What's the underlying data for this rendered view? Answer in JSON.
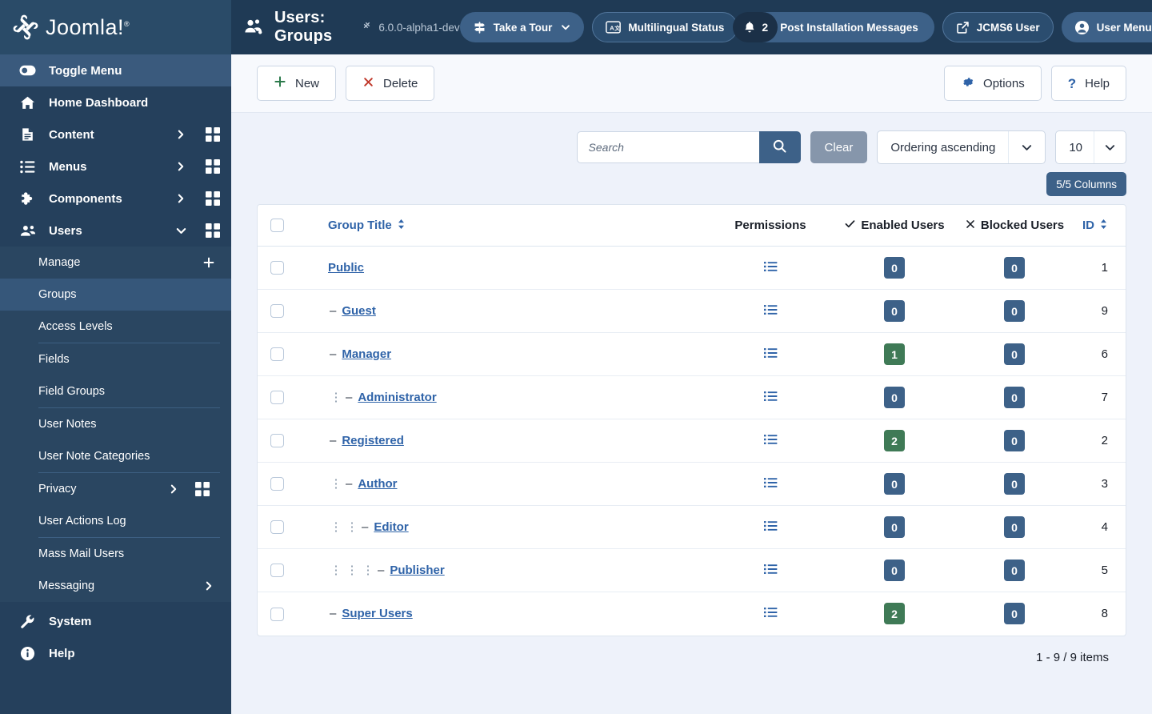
{
  "brand": {
    "name": "Joomla!",
    "trademark": "®"
  },
  "header": {
    "page_icon": "users-gear-icon",
    "page_title": "Users: Groups",
    "version": "6.0.0-alpha1-dev",
    "version_icon": "joomla-mark-icon",
    "actions": {
      "tour": {
        "label": "Take a Tour",
        "icon": "signpost-icon",
        "chevron": "chevron-down-icon"
      },
      "multilingual": {
        "label": "Multilingual Status",
        "icon": "translate-icon"
      },
      "messages": {
        "label": "Post Installation Messages",
        "icon": "bell-icon",
        "count": "2"
      },
      "site": {
        "label": "JCMS6 User",
        "icon": "external-link-icon"
      },
      "user": {
        "label": "User Menu",
        "icon": "user-circle-icon",
        "chevron": "chevron-down-icon"
      }
    }
  },
  "sidebar": {
    "toggle": {
      "label": "Toggle Menu",
      "icon": "toggle-switch-icon"
    },
    "items": [
      {
        "label": "Home Dashboard",
        "icon": "home-icon",
        "arrow": null,
        "grid": false
      },
      {
        "label": "Content",
        "icon": "document-icon",
        "arrow": "chevron-right-icon",
        "grid": true
      },
      {
        "label": "Menus",
        "icon": "list-icon",
        "arrow": "chevron-right-icon",
        "grid": true
      },
      {
        "label": "Components",
        "icon": "puzzle-icon",
        "arrow": "chevron-right-icon",
        "grid": true
      },
      {
        "label": "Users",
        "icon": "users-icon",
        "arrow": "chevron-down-icon",
        "grid": true,
        "expanded": true
      }
    ],
    "sub_items": [
      {
        "label": "Manage",
        "plus": true,
        "divider_after": false
      },
      {
        "label": "Groups",
        "current": true,
        "divider_after": false
      },
      {
        "label": "Access Levels",
        "divider_after": true
      },
      {
        "label": "Fields",
        "divider_after": false
      },
      {
        "label": "Field Groups",
        "divider_after": true
      },
      {
        "label": "User Notes",
        "divider_after": false
      },
      {
        "label": "User Note Categories",
        "divider_after": true
      },
      {
        "label": "Privacy",
        "arrow": "chevron-right-icon",
        "grid": true,
        "divider_after": false
      },
      {
        "label": "User Actions Log",
        "divider_after": true
      },
      {
        "label": "Mass Mail Users",
        "divider_after": false
      },
      {
        "label": "Messaging",
        "arrow": "chevron-right-icon",
        "divider_after": false
      }
    ],
    "bottom_items": [
      {
        "label": "System",
        "icon": "wrench-icon"
      },
      {
        "label": "Help",
        "icon": "info-circle-icon"
      }
    ]
  },
  "toolbar": {
    "new_label": "New",
    "new_icon": "plus-icon",
    "delete_label": "Delete",
    "delete_icon": "x-icon",
    "options_label": "Options",
    "options_icon": "gear-icon",
    "help_label": "Help",
    "help_icon": "question-icon"
  },
  "filters": {
    "search_placeholder": "Search",
    "search_value": "",
    "search_icon": "search-icon",
    "clear_label": "Clear",
    "ordering_value": "Ordering ascending",
    "limit_value": "10",
    "columns_label": "5/5 Columns"
  },
  "table": {
    "headers": {
      "group_title": "Group Title",
      "permissions": "Permissions",
      "enabled_users": "Enabled Users",
      "blocked_users": "Blocked Users",
      "id": "ID"
    },
    "header_icons": {
      "sort": "sort-icon",
      "enabled": "check-icon",
      "blocked": "x-icon"
    },
    "rows": [
      {
        "title": "Public",
        "level": 0,
        "dash": false,
        "permissions_icon": "list-ul-icon",
        "enabled": "0",
        "blocked": "0",
        "id": "1"
      },
      {
        "title": "Guest",
        "level": 0,
        "dash": true,
        "permissions_icon": "list-ul-icon",
        "enabled": "0",
        "blocked": "0",
        "id": "9"
      },
      {
        "title": "Manager",
        "level": 0,
        "dash": true,
        "permissions_icon": "list-ul-icon",
        "enabled": "1",
        "blocked": "0",
        "id": "6"
      },
      {
        "title": "Administrator",
        "level": 1,
        "dash": true,
        "permissions_icon": "list-ul-icon",
        "enabled": "0",
        "blocked": "0",
        "id": "7"
      },
      {
        "title": "Registered",
        "level": 0,
        "dash": true,
        "permissions_icon": "list-ul-icon",
        "enabled": "2",
        "blocked": "0",
        "id": "2"
      },
      {
        "title": "Author",
        "level": 1,
        "dash": true,
        "permissions_icon": "list-ul-icon",
        "enabled": "0",
        "blocked": "0",
        "id": "3"
      },
      {
        "title": "Editor",
        "level": 2,
        "dash": true,
        "permissions_icon": "list-ul-icon",
        "enabled": "0",
        "blocked": "0",
        "id": "4"
      },
      {
        "title": "Publisher",
        "level": 3,
        "dash": true,
        "permissions_icon": "list-ul-icon",
        "enabled": "0",
        "blocked": "0",
        "id": "5"
      },
      {
        "title": "Super Users",
        "level": 0,
        "dash": true,
        "permissions_icon": "list-ul-icon",
        "enabled": "2",
        "blocked": "0",
        "id": "8"
      }
    ],
    "pagination": "1 - 9 / 9 items"
  },
  "colors": {
    "brand_dark": "#2a4b68",
    "topbar": "#1f3a55",
    "sidebar": "#25405c",
    "sidebar_sub": "#2a4661",
    "sidebar_current": "#36577a",
    "accent_blue": "#3d6188",
    "link_blue": "#2f63a8",
    "badge_zero": "#3d6188",
    "badge_positive": "#3f7a56",
    "clear_gray": "#8696ab",
    "page_bg": "#eef2fa"
  }
}
